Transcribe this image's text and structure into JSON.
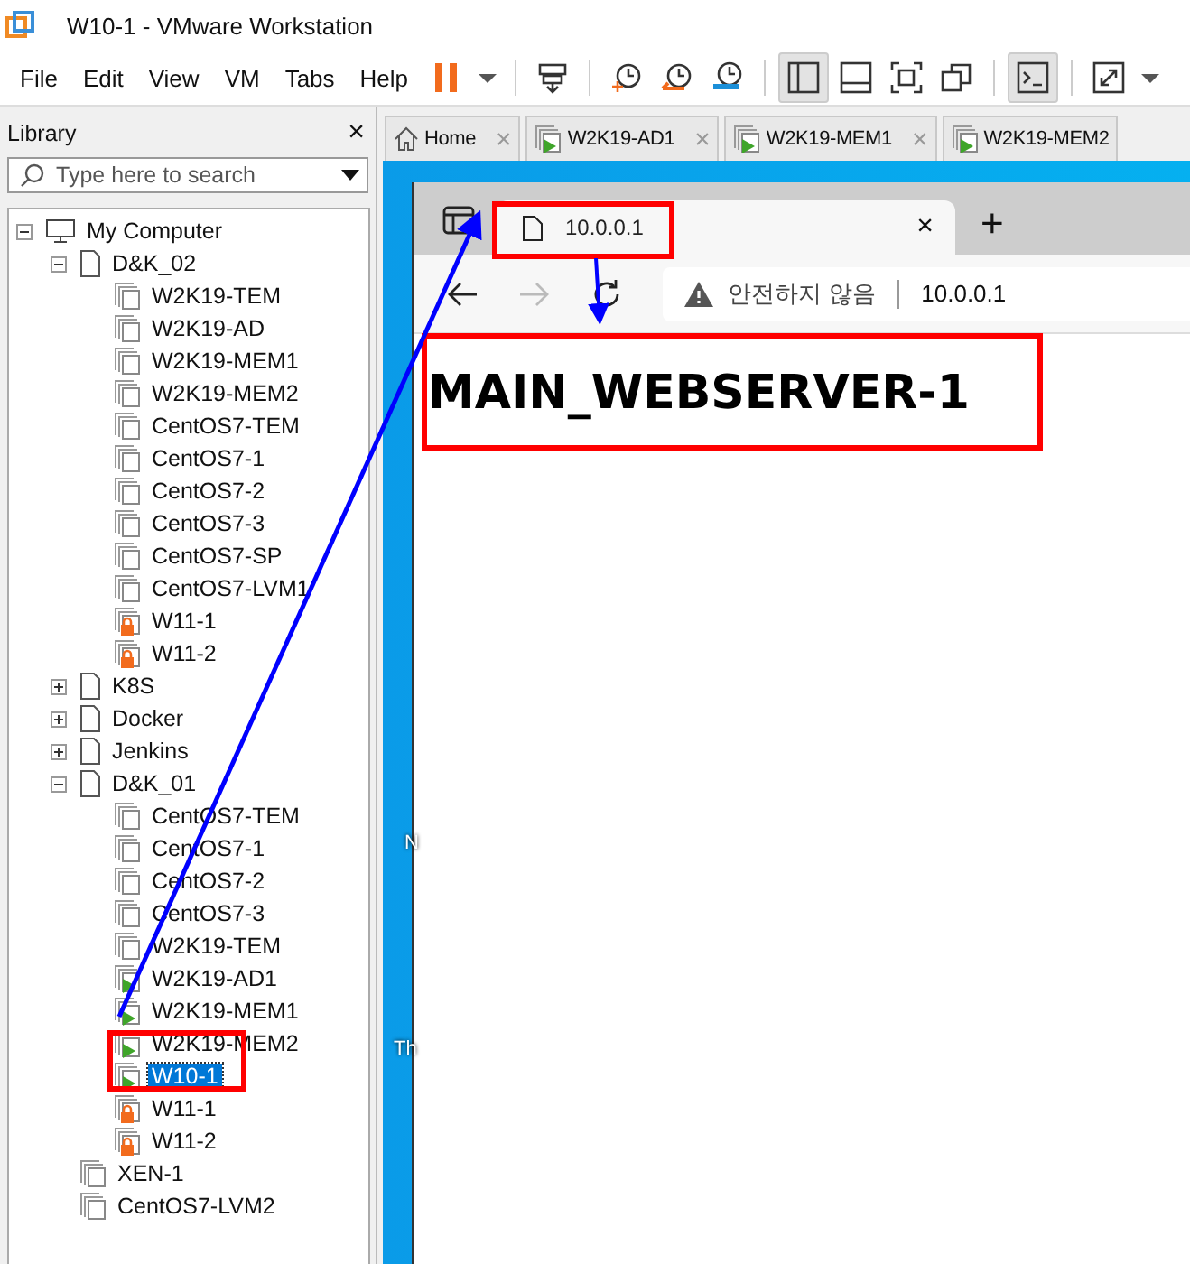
{
  "window": {
    "title": "W10-1 - VMware Workstation"
  },
  "menu": [
    "File",
    "Edit",
    "View",
    "VM",
    "Tabs",
    "Help"
  ],
  "toolbar": [
    {
      "kind": "pause"
    },
    {
      "kind": "dropdown"
    },
    {
      "kind": "sep"
    },
    {
      "kind": "send-keys"
    },
    {
      "kind": "sep"
    },
    {
      "kind": "snapshot"
    },
    {
      "kind": "revert"
    },
    {
      "kind": "manager"
    },
    {
      "kind": "sep"
    },
    {
      "kind": "library",
      "pressed": true
    },
    {
      "kind": "thumbs",
      "pressed": false
    },
    {
      "kind": "fullscreen",
      "pressed": false
    },
    {
      "kind": "unity",
      "pressed": false
    },
    {
      "kind": "sep"
    },
    {
      "kind": "console",
      "pressed": true
    },
    {
      "kind": "sep"
    },
    {
      "kind": "stretch",
      "pressed": false
    },
    {
      "kind": "dropdown"
    }
  ],
  "library": {
    "title": "Library",
    "close": "×",
    "search": {
      "placeholder": "Type here to search"
    },
    "tree": [
      {
        "kind": "computer",
        "label": "My Computer",
        "expanded": true,
        "children": [
          {
            "kind": "folder",
            "label": "D&K_02",
            "expanded": true,
            "children": [
              {
                "kind": "vm",
                "label": "W2K19-TEM",
                "running": false,
                "locked": false,
                "selected": false
              },
              {
                "kind": "vm",
                "label": "W2K19-AD",
                "running": false,
                "locked": false,
                "selected": false
              },
              {
                "kind": "vm",
                "label": "W2K19-MEM1",
                "running": false,
                "locked": false,
                "selected": false
              },
              {
                "kind": "vm",
                "label": "W2K19-MEM2",
                "running": false,
                "locked": false,
                "selected": false
              },
              {
                "kind": "vm",
                "label": "CentOS7-TEM",
                "running": false,
                "locked": false,
                "selected": false
              },
              {
                "kind": "vm",
                "label": "CentOS7-1",
                "running": false,
                "locked": false,
                "selected": false
              },
              {
                "kind": "vm",
                "label": "CentOS7-2",
                "running": false,
                "locked": false,
                "selected": false
              },
              {
                "kind": "vm",
                "label": "CentOS7-3",
                "running": false,
                "locked": false,
                "selected": false
              },
              {
                "kind": "vm",
                "label": "CentOS7-SP",
                "running": false,
                "locked": false,
                "selected": false
              },
              {
                "kind": "vm",
                "label": "CentOS7-LVM1",
                "running": false,
                "locked": false,
                "selected": false
              },
              {
                "kind": "vm",
                "label": "W11-1",
                "running": false,
                "locked": true,
                "selected": false
              },
              {
                "kind": "vm",
                "label": "W11-2",
                "running": false,
                "locked": true,
                "selected": false
              }
            ]
          },
          {
            "kind": "folder",
            "label": "K8S",
            "expanded": false
          },
          {
            "kind": "folder",
            "label": "Docker",
            "expanded": false
          },
          {
            "kind": "folder",
            "label": "Jenkins",
            "expanded": false
          },
          {
            "kind": "folder",
            "label": "D&K_01",
            "expanded": true,
            "children": [
              {
                "kind": "vm",
                "label": "CentOS7-TEM",
                "running": false,
                "locked": false,
                "selected": false
              },
              {
                "kind": "vm",
                "label": "CentOS7-1",
                "running": false,
                "locked": false,
                "selected": false
              },
              {
                "kind": "vm",
                "label": "CentOS7-2",
                "running": false,
                "locked": false,
                "selected": false
              },
              {
                "kind": "vm",
                "label": "CentOS7-3",
                "running": false,
                "locked": false,
                "selected": false
              },
              {
                "kind": "vm",
                "label": "W2K19-TEM",
                "running": false,
                "locked": false,
                "selected": false
              },
              {
                "kind": "vm",
                "label": "W2K19-AD1",
                "running": true,
                "locked": false,
                "selected": false
              },
              {
                "kind": "vm",
                "label": "W2K19-MEM1",
                "running": true,
                "locked": false,
                "selected": false
              },
              {
                "kind": "vm",
                "label": "W2K19-MEM2",
                "running": true,
                "locked": false,
                "selected": false
              },
              {
                "kind": "vm",
                "label": "W10-1",
                "running": true,
                "locked": false,
                "selected": true
              },
              {
                "kind": "vm",
                "label": "W11-1",
                "running": false,
                "locked": true,
                "selected": false
              },
              {
                "kind": "vm",
                "label": "W11-2",
                "running": false,
                "locked": true,
                "selected": false
              }
            ]
          },
          {
            "kind": "vm",
            "label": "XEN-1",
            "running": false,
            "locked": false,
            "selected": false
          },
          {
            "kind": "vm",
            "label": "CentOS7-LVM2",
            "running": false,
            "locked": false,
            "selected": false
          }
        ]
      }
    ]
  },
  "tabs": [
    {
      "kind": "home",
      "label": "Home",
      "close": "×",
      "selected": false
    },
    {
      "kind": "vm",
      "label": "W2K19-AD1",
      "close": "×",
      "selected": false
    },
    {
      "kind": "vm",
      "label": "W2K19-MEM1",
      "close": "×",
      "selected": false
    },
    {
      "kind": "vm",
      "label": "W2K19-MEM2",
      "selected": false
    }
  ],
  "desktop_icons": [
    "N",
    "Th"
  ],
  "browser": {
    "tab": {
      "title": "10.0.0.1",
      "close": "×"
    },
    "new_tab": "+",
    "forward_disabled": true,
    "address": {
      "warning": "안전하지 않음",
      "url": "10.0.0.1"
    },
    "heading": "MAIN_WEBSERVER-1"
  }
}
